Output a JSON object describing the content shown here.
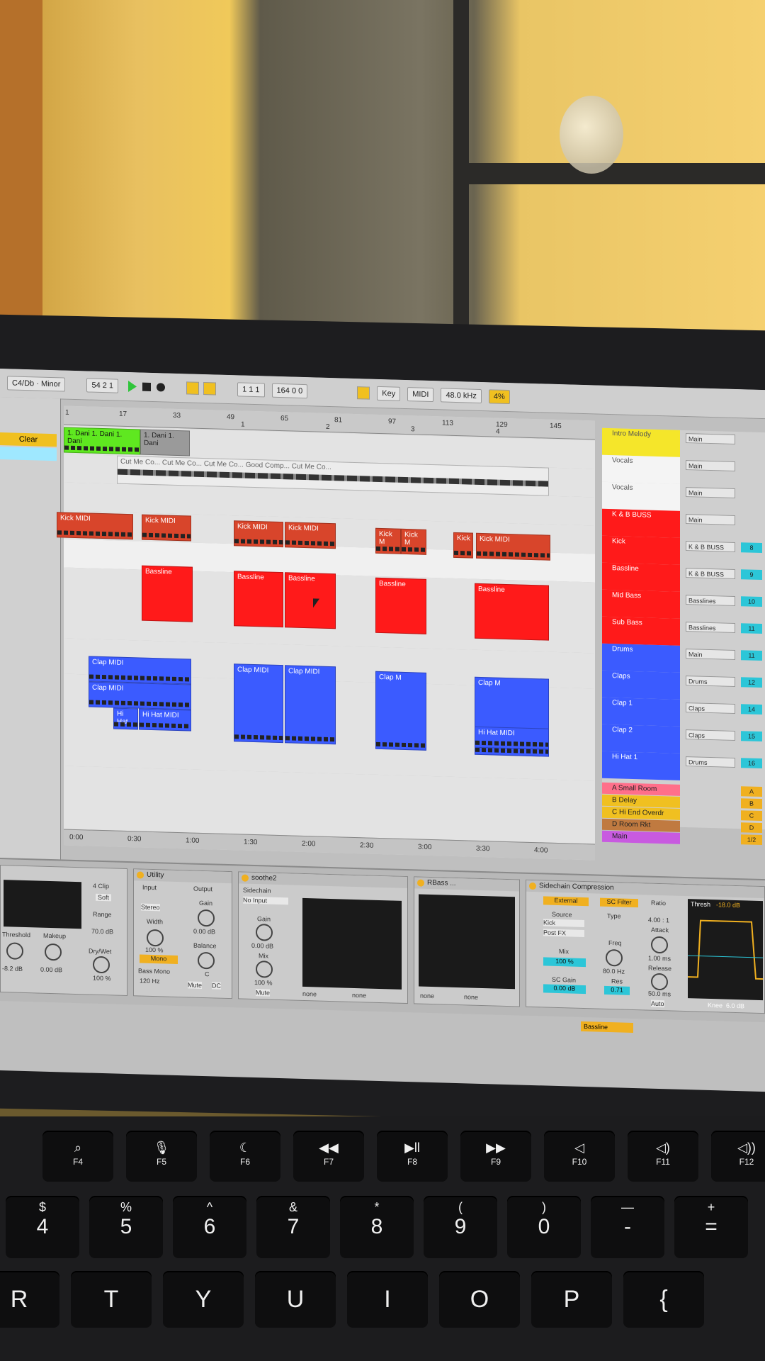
{
  "topbar": {
    "key_scale": "C4/Db · Minor",
    "position": "54 2 1",
    "loop_start": "1 1 1",
    "tempo_field": "164 0 0",
    "key_label": "Key",
    "midi_label": "MIDI",
    "cpu": "48.0 kHz",
    "cpu2": "4%"
  },
  "left": {
    "clear_label": "Clear"
  },
  "ruler": [
    "1",
    "17",
    "33",
    "49",
    "65",
    "81",
    "97",
    "113",
    "129",
    "145"
  ],
  "scenes": [
    "1",
    "2",
    "3",
    "4"
  ],
  "timeline": [
    "0:00",
    "0:30",
    "1:00",
    "1:30",
    "2:00",
    "2:30",
    "3:00",
    "3:30",
    "4:00"
  ],
  "clips": {
    "lime": "1. Dani  1. Dani  1. Dani",
    "grey": "1. Dani  1. Dani",
    "vocal": "Cut Me Co...  Cut Me Co...  Cut Me Co...  Good Comp...  Cut Me Co...",
    "kick": [
      "Kick MIDI",
      "Kick MIDI",
      "Kick MIDI",
      "Kick MIDI",
      "Kick M",
      "Kick M",
      "Kick",
      "Kick MIDI"
    ],
    "bass": [
      "Bassline",
      "Bassline",
      "Bassline",
      "Bassline",
      "Bassline"
    ],
    "clap": [
      "Clap MIDI",
      "Clap MIDI",
      "Clap MIDI",
      "Clap MIDI",
      "Clap M",
      "Clap M",
      "Clap M",
      "Clap M"
    ],
    "hihat": [
      "Hi Hat",
      "Hi Hat MIDI",
      "Hi Hat MIDI",
      "Hi Hat MIDI",
      "Hi Hat MIDI"
    ]
  },
  "tracks": [
    {
      "name": "Intro Melody",
      "route": "Main",
      "num": "",
      "color": "#f5e62a"
    },
    {
      "name": "Vocals",
      "route": "Main",
      "num": "",
      "color": "#f4f4f4"
    },
    {
      "name": "Vocals",
      "route": "Main",
      "num": "",
      "color": "#f4f4f4"
    },
    {
      "name": "K & B BUSS",
      "route": "Main",
      "num": "",
      "color": "#ff1a1a"
    },
    {
      "name": "Kick",
      "route": "K & B BUSS",
      "num": "8",
      "color": "#ff1a1a"
    },
    {
      "name": "Bassline",
      "route": "K & B BUSS",
      "num": "9",
      "color": "#ff1a1a"
    },
    {
      "name": "Mid Bass",
      "route": "Basslines",
      "num": "10",
      "color": "#ff1a1a"
    },
    {
      "name": "Sub Bass",
      "route": "Basslines",
      "num": "11",
      "color": "#ff1a1a"
    },
    {
      "name": "Drums",
      "route": "Main",
      "num": "11",
      "color": "#3b5bff"
    },
    {
      "name": "Claps",
      "route": "Drums",
      "num": "12",
      "color": "#3b5bff"
    },
    {
      "name": "Clap 1",
      "route": "Claps",
      "num": "14",
      "color": "#3b5bff"
    },
    {
      "name": "Clap 2",
      "route": "Claps",
      "num": "15",
      "color": "#3b5bff"
    },
    {
      "name": "Hi Hat 1",
      "route": "Drums",
      "num": "16",
      "color": "#3b5bff"
    }
  ],
  "returns": [
    {
      "name": "A Small Room",
      "letter": "A",
      "color": "#ff6f8a"
    },
    {
      "name": "B Delay",
      "letter": "B",
      "color": "#f0c020"
    },
    {
      "name": "C Hi End Overdr",
      "letter": "C",
      "color": "#f0c020"
    },
    {
      "name": "D Room Rkt",
      "letter": "D",
      "color": "#c07a40"
    },
    {
      "name": "Main",
      "letter": "1/2",
      "color": "#c85ae0"
    }
  ],
  "devices": {
    "compressor": {
      "ratio": "4 Clip",
      "soft": "Soft",
      "range": "Range",
      "range_val": "70.0 dB",
      "drywet": "Dry/Wet",
      "drywet_val": "100 %",
      "threshold": "Threshold",
      "makeup": "Makeup",
      "thr_val": "-8.2 dB",
      "mk_val": "0.00 dB"
    },
    "utility": {
      "title": "Utility",
      "input": "Input",
      "output": "Output",
      "gain": "Gain",
      "gain_val": "0.00 dB",
      "width": "Width",
      "width_val": "100 %",
      "mono": "Mono",
      "balance": "Balance",
      "balance_val": "C",
      "bass_mono": "Bass Mono",
      "freq": "120 Hz",
      "mute": "Mute",
      "dc": "DC",
      "stereo": "Stereo"
    },
    "soothe": {
      "title": "soothe2",
      "sidechain": "Sidechain",
      "no_input": "No Input",
      "gain": "Gain",
      "gain_val": "0.00 dB",
      "mix": "Mix",
      "mix_val": "100 %",
      "mute": "Mute",
      "none1": "none",
      "none2": "none"
    },
    "rbass": {
      "title": "RBass ...",
      "none1": "none",
      "none2": "none"
    },
    "sidechain": {
      "title": "Sidechain Compression",
      "external": "External",
      "sc_filter": "SC Filter",
      "source": "Source",
      "type": "Type",
      "kick": "Kick",
      "postfx": "Post FX",
      "mix": "Mix",
      "mix_val": "100 %",
      "freq": "Freq",
      "freq_val": "80.0 Hz",
      "sc_gain": "SC Gain",
      "sc_gain_val": "0.00 dB",
      "res": "Res",
      "res_val": "0.71",
      "ratio": "Ratio",
      "ratio_val": "4.00 : 1",
      "attack": "Attack",
      "attack_val": "1.00 ms",
      "release": "Release",
      "release_val": "50.0 ms",
      "auto": "Auto",
      "thresh_label": "Thresh",
      "thresh_val": "-18.0 dB",
      "knee": "Knee",
      "knee_val": "6.0 dB"
    }
  },
  "status": {
    "bassline": "Bassline"
  },
  "keyboard": {
    "fkeys": [
      {
        "sym": "⌕",
        "fn": "F4"
      },
      {
        "sym": "🎙",
        "fn": "F5"
      },
      {
        "sym": "☾",
        "fn": "F6"
      },
      {
        "sym": "◀◀",
        "fn": "F7"
      },
      {
        "sym": "▶ll",
        "fn": "F8"
      },
      {
        "sym": "▶▶",
        "fn": "F9"
      },
      {
        "sym": "◁",
        "fn": "F10"
      },
      {
        "sym": "◁)",
        "fn": "F11"
      },
      {
        "sym": "◁))",
        "fn": "F12"
      }
    ],
    "numkeys": [
      {
        "top": "$",
        "bot": "4"
      },
      {
        "top": "%",
        "bot": "5"
      },
      {
        "top": "^",
        "bot": "6"
      },
      {
        "top": "&",
        "bot": "7"
      },
      {
        "top": "*",
        "bot": "8"
      },
      {
        "top": "(",
        "bot": "9"
      },
      {
        "top": ")",
        "bot": "0"
      },
      {
        "top": "—",
        "bot": "-"
      },
      {
        "top": "+",
        "bot": "="
      }
    ],
    "letters": [
      "R",
      "T",
      "Y",
      "U",
      "I",
      "O",
      "P",
      "{"
    ]
  }
}
